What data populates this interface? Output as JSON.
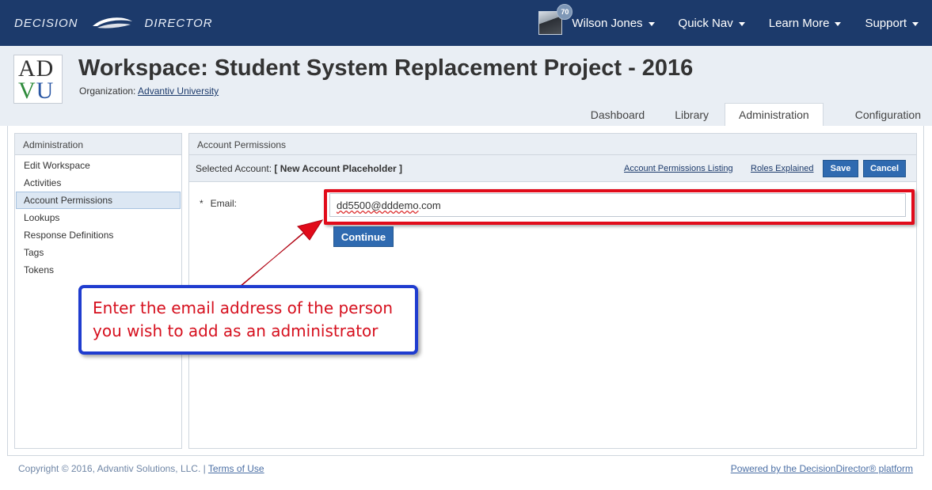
{
  "brand": {
    "left": "DECISION",
    "right": "DIRECTOR"
  },
  "nav": {
    "badge_count": "70",
    "user_name": "Wilson Jones",
    "quick_nav": "Quick Nav",
    "learn_more": "Learn More",
    "support": "Support"
  },
  "logo": {
    "line1_a": "AD",
    "line2_a": "V",
    "line2_b": "U"
  },
  "workspace": {
    "title": "Workspace: Student System Replacement Project - 2016",
    "org_label": "Organization:",
    "org_name": "Advantiv University"
  },
  "tabs": [
    {
      "label": "Dashboard"
    },
    {
      "label": "Library"
    },
    {
      "label": "Administration",
      "active": true
    },
    {
      "label": "Configuration"
    }
  ],
  "sidebar": {
    "heading": "Administration",
    "items": [
      {
        "label": "Edit Workspace"
      },
      {
        "label": "Activities"
      },
      {
        "label": "Account Permissions",
        "active": true
      },
      {
        "label": "Lookups"
      },
      {
        "label": "Response Definitions"
      },
      {
        "label": "Tags"
      },
      {
        "label": "Tokens"
      }
    ]
  },
  "content": {
    "heading": "Account Permissions",
    "selected_label": "Selected Account:",
    "selected_value": "[ New Account Placeholder ]",
    "listing_link": "Account Permissions Listing",
    "roles_link": "Roles Explained",
    "save_label": "Save",
    "cancel_label": "Cancel",
    "required_mark": "*",
    "email_label": "Email:",
    "email_value_part1": "dd5500@dddemo",
    "email_value_part2": ".com",
    "continue_label": "Continue"
  },
  "callout": {
    "text": "Enter the email address of the person you wish to add as an administrator",
    "arrow_color": "#e10b1a",
    "border_color": "#1f3ccf",
    "text_color": "#d6101e"
  },
  "footer": {
    "copyright": "Copyright © 2016, Advantiv Solutions, LLC.  |",
    "terms": "Terms of Use",
    "powered": "Powered by the DecisionDirector® platform"
  },
  "colors": {
    "navbar": "#1c3a6b",
    "header_bg": "#e9eef4",
    "button": "#2f6ab0"
  }
}
